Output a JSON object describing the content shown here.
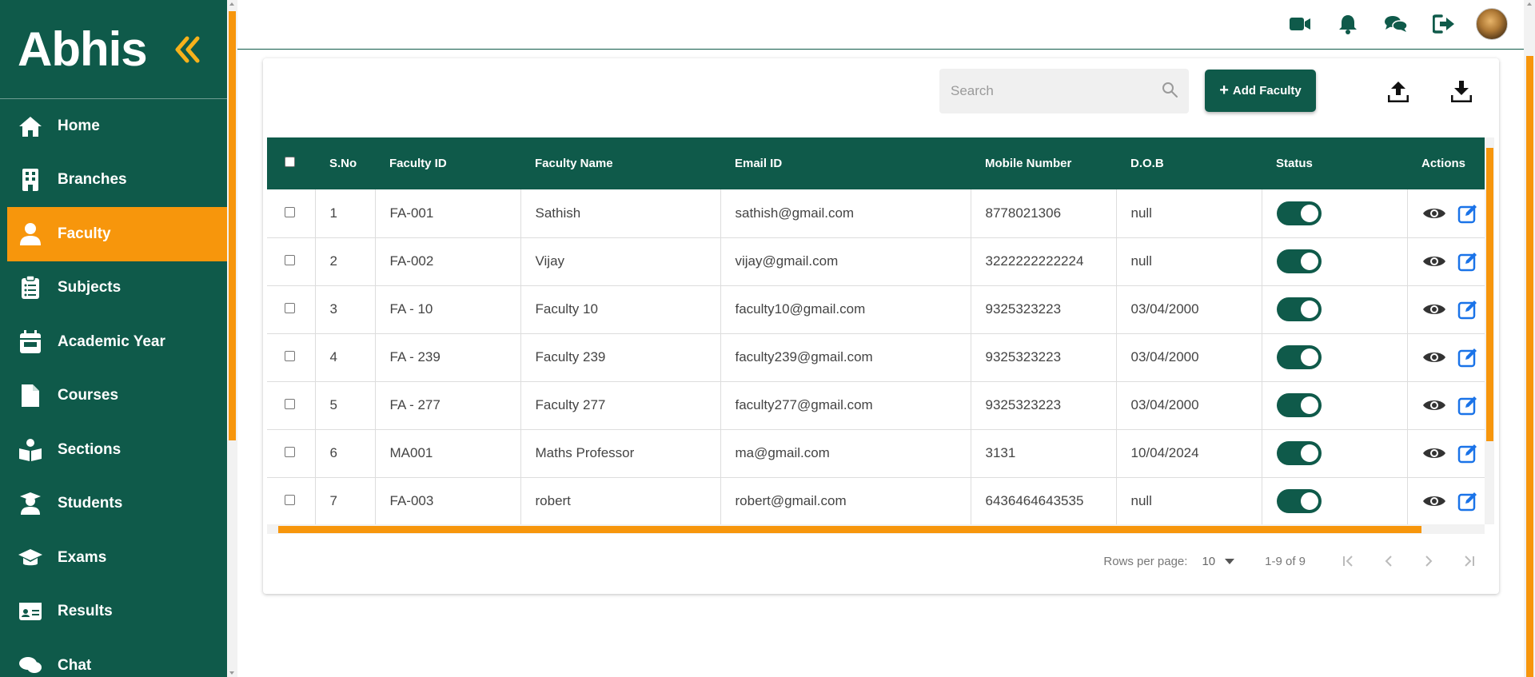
{
  "brand": {
    "name": "Abhis"
  },
  "colors": {
    "primary": "#0f5a4a",
    "accent": "#f7960c",
    "link": "#1a73e8"
  },
  "sidebar": {
    "items": [
      {
        "label": "Home",
        "icon": "home-icon",
        "active": false
      },
      {
        "label": "Branches",
        "icon": "building-icon",
        "active": false
      },
      {
        "label": "Faculty",
        "icon": "user-icon",
        "active": true
      },
      {
        "label": "Subjects",
        "icon": "clipboard-icon",
        "active": false
      },
      {
        "label": "Academic Year",
        "icon": "calendar-icon",
        "active": false
      },
      {
        "label": "Courses",
        "icon": "file-icon",
        "active": false
      },
      {
        "label": "Sections",
        "icon": "reader-icon",
        "active": false
      },
      {
        "label": "Students",
        "icon": "student-icon",
        "active": false
      },
      {
        "label": "Exams",
        "icon": "graduation-cap-icon",
        "active": false
      },
      {
        "label": "Results",
        "icon": "id-card-icon",
        "active": false
      },
      {
        "label": "Chat",
        "icon": "chat-icon",
        "active": false
      }
    ]
  },
  "topbar": {
    "icons": [
      "video-icon",
      "bell-icon",
      "comments-icon",
      "logout-icon"
    ]
  },
  "toolbar": {
    "search_placeholder": "Search",
    "add_label": "Add Faculty",
    "icons": [
      "upload-icon",
      "download-icon"
    ]
  },
  "table": {
    "headers": [
      "S.No",
      "Faculty ID",
      "Faculty Name",
      "Email ID",
      "Mobile Number",
      "D.O.B",
      "Status",
      "Actions"
    ],
    "rows": [
      {
        "sno": "1",
        "faculty_id": "FA-001",
        "name": "Sathish",
        "email": "sathish@gmail.com",
        "mobile": "8778021306",
        "dob": "null",
        "status": true
      },
      {
        "sno": "2",
        "faculty_id": "FA-002",
        "name": "Vijay",
        "email": "vijay@gmail.com",
        "mobile": "3222222222224",
        "dob": "null",
        "status": true
      },
      {
        "sno": "3",
        "faculty_id": "FA - 10",
        "name": "Faculty 10",
        "email": "faculty10@gmail.com",
        "mobile": "9325323223",
        "dob": "03/04/2000",
        "status": true
      },
      {
        "sno": "4",
        "faculty_id": "FA - 239",
        "name": "Faculty 239",
        "email": "faculty239@gmail.com",
        "mobile": "9325323223",
        "dob": "03/04/2000",
        "status": true
      },
      {
        "sno": "5",
        "faculty_id": "FA - 277",
        "name": "Faculty 277",
        "email": "faculty277@gmail.com",
        "mobile": "9325323223",
        "dob": "03/04/2000",
        "status": true
      },
      {
        "sno": "6",
        "faculty_id": "MA001",
        "name": "Maths Professor",
        "email": "ma@gmail.com",
        "mobile": "3131",
        "dob": "10/04/2024",
        "status": true
      },
      {
        "sno": "7",
        "faculty_id": "FA-003",
        "name": "robert",
        "email": "robert@gmail.com",
        "mobile": "6436464643535",
        "dob": "null",
        "status": true
      }
    ]
  },
  "pagination": {
    "rows_per_page_label": "Rows per page:",
    "rows_per_page_value": "10",
    "range": "1-9 of 9"
  }
}
